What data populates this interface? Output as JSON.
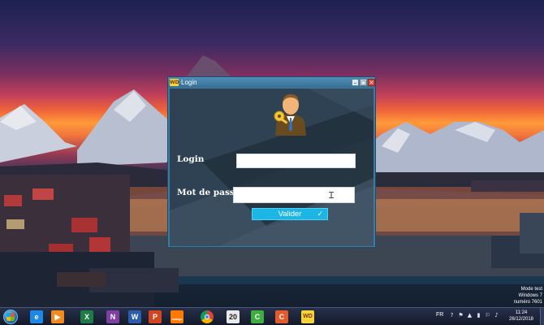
{
  "window": {
    "title": "Login",
    "app_icon": "WD",
    "controls": {
      "minimize": "–",
      "maximize": "□",
      "close": "✕"
    }
  },
  "form": {
    "login_label": "Login",
    "login_value": "",
    "password_label": "Mot de passe",
    "password_value": "",
    "submit_label": "Valider",
    "submit_icon": "✓"
  },
  "watermark": {
    "line1": "Mode test",
    "line2": "Windows 7",
    "line3": "numéro 7601"
  },
  "taskbar": {
    "apps": [
      {
        "name": "internet-explorer-icon",
        "glyph": "e",
        "color": "#1e88e5"
      },
      {
        "name": "media-player-icon",
        "glyph": "▶",
        "color": "#f28b1e"
      },
      {
        "name": "excel-icon",
        "glyph": "X",
        "color": "#1e7b45"
      },
      {
        "name": "onenote-icon",
        "glyph": "N",
        "color": "#7e3fa0"
      },
      {
        "name": "word-icon",
        "glyph": "W",
        "color": "#2a5daa"
      },
      {
        "name": "powerpoint-icon",
        "glyph": "P",
        "color": "#d2461f"
      },
      {
        "name": "orange-icon",
        "glyph": "orange",
        "color": "#ff7900"
      },
      {
        "name": "chrome-icon",
        "glyph": "",
        "color": "#e7e7e7"
      },
      {
        "name": "app-20-icon",
        "glyph": "20",
        "color": "#e9e9e9"
      },
      {
        "name": "camtasia-green-icon",
        "glyph": "C",
        "color": "#3fae3f"
      },
      {
        "name": "camtasia-orange-icon",
        "glyph": "C",
        "color": "#e45a2a"
      },
      {
        "name": "windev-icon",
        "glyph": "WD",
        "color": "#f6d33a"
      }
    ],
    "language": "FR",
    "clock_time": "11:24",
    "clock_date": "26/12/2018"
  }
}
